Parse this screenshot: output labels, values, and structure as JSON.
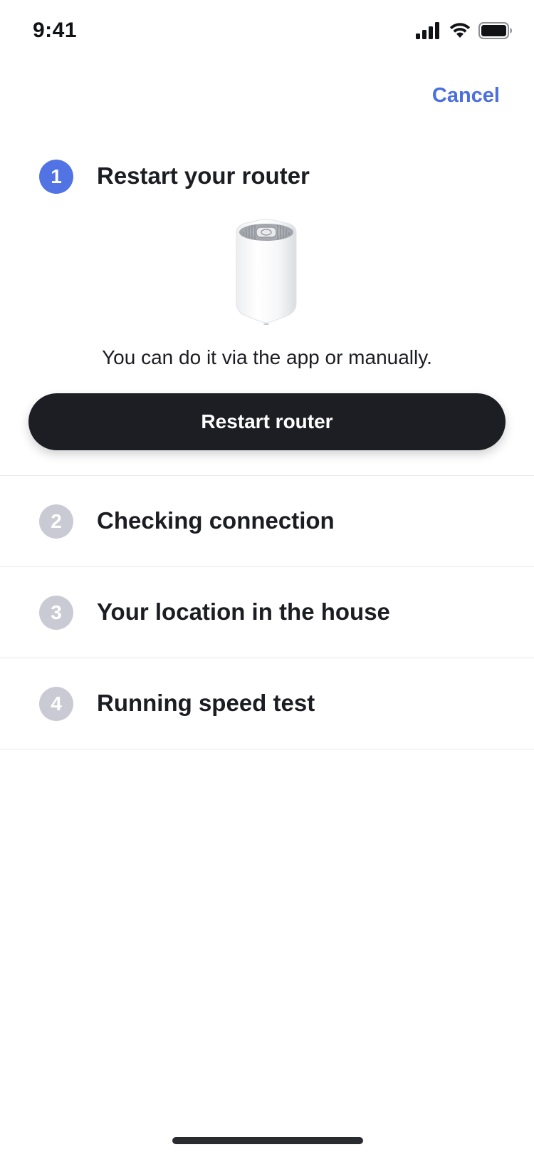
{
  "status_bar": {
    "time": "9:41",
    "icons": [
      "cellular-signal-icon",
      "wifi-icon",
      "battery-icon"
    ]
  },
  "header": {
    "cancel_label": "Cancel"
  },
  "steps": [
    {
      "number": "1",
      "title": "Restart your router",
      "state": "active",
      "description": "You can do it via the app or manually.",
      "button_label": "Restart router",
      "illustration": "router-icon"
    },
    {
      "number": "2",
      "title": "Checking connection",
      "state": "pending"
    },
    {
      "number": "3",
      "title": "Your location in the house",
      "state": "pending"
    },
    {
      "number": "4",
      "title": "Running speed test",
      "state": "pending"
    }
  ],
  "colors": {
    "accent": "#5173e4",
    "link": "#4b6fe0",
    "pending_badge": "#c9cad4",
    "button_bg": "#1d1e23",
    "text": "#1c1d22"
  }
}
